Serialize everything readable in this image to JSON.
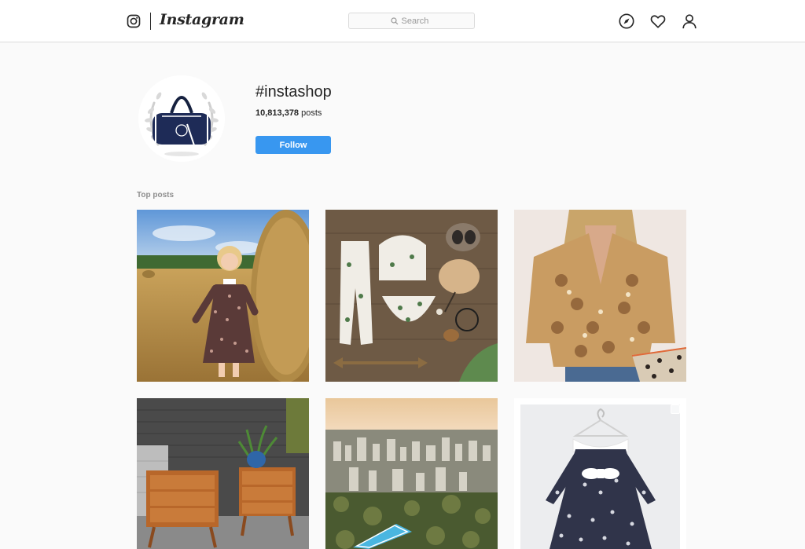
{
  "app": {
    "brand": "Instagram"
  },
  "header": {
    "search_placeholder": "Search",
    "icons": [
      "instagram-glyph-icon",
      "compass-icon",
      "heart-icon",
      "user-icon"
    ]
  },
  "hashtag": {
    "title": "#instashop",
    "posts_count": "10,813,378",
    "posts_label": "posts",
    "follow_label": "Follow"
  },
  "sections": {
    "top_posts_label": "Top posts"
  },
  "posts": [
    {
      "subject": "girl-in-floral-dress-hay-field"
    },
    {
      "subject": "baby-clothing-flat-lay",
      "sign_text": "I knew when I met you an adventure was going to happen"
    },
    {
      "subject": "paisley-blouse-outfit"
    },
    {
      "subject": "wooden-nightstands"
    },
    {
      "subject": "city-aerial-view"
    },
    {
      "subject": "floral-baby-dress-on-hanger",
      "multi": true
    }
  ],
  "colors": {
    "accent": "#3897f0",
    "background": "#fafafa",
    "border": "#dbdbdb"
  }
}
